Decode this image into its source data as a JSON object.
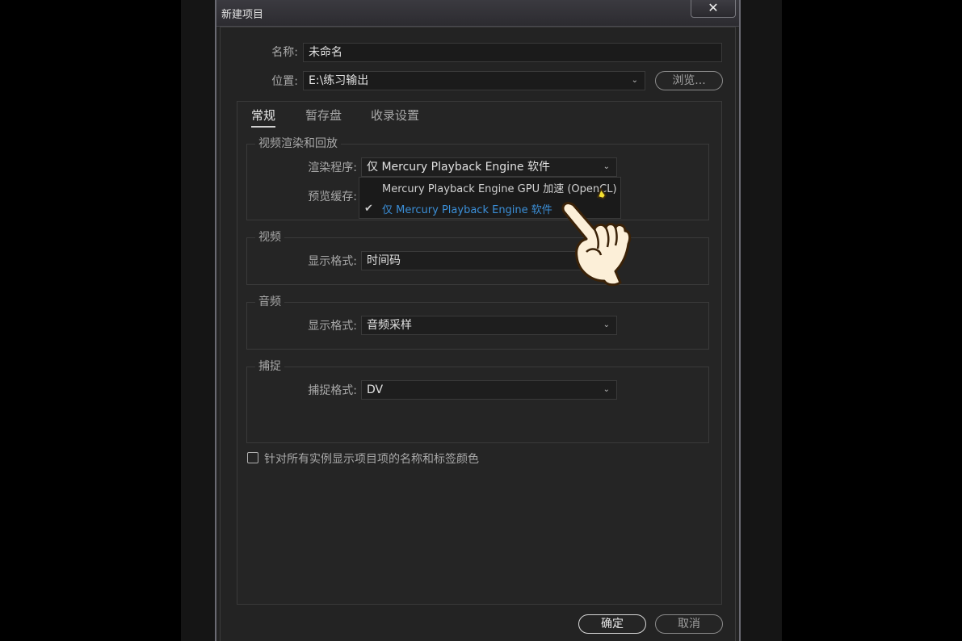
{
  "window": {
    "title": "新建项目",
    "close_label": "✕"
  },
  "name_row": {
    "label": "名称:",
    "value": "未命名"
  },
  "location_row": {
    "label": "位置:",
    "value": "E:\\练习输出",
    "browse_label": "浏览..."
  },
  "tabs": [
    {
      "label": "常规",
      "active": true
    },
    {
      "label": "暂存盘",
      "active": false
    },
    {
      "label": "收录设置",
      "active": false
    }
  ],
  "groups": {
    "render": {
      "title": "视频渲染和回放",
      "renderer_label": "渲染程序:",
      "renderer_value": "仅 Mercury Playback Engine 软件",
      "preview_cache_label": "预览缓存:"
    },
    "video": {
      "title": "视频",
      "format_label": "显示格式:",
      "format_value": "时间码"
    },
    "audio": {
      "title": "音频",
      "format_label": "显示格式:",
      "format_value": "音频采样"
    },
    "capture": {
      "title": "捕捉",
      "format_label": "捕捉格式:",
      "format_value": "DV"
    }
  },
  "dropdown_options": [
    {
      "label": "Mercury Playback Engine GPU 加速 (OpenCL)",
      "selected": false
    },
    {
      "label": "仅 Mercury Playback Engine 软件",
      "selected": true
    }
  ],
  "checkbox": {
    "label": "针对所有实例显示项目项的名称和标签颜色",
    "checked": false
  },
  "footer": {
    "ok_label": "确定",
    "cancel_label": "取消"
  },
  "colors": {
    "accent_selected": "#3b8fd8",
    "dialog_bg": "#232323"
  },
  "icons": {
    "chevron": "chevron-down-icon",
    "check": "check-icon",
    "cursor": "pointing-hand-icon"
  }
}
